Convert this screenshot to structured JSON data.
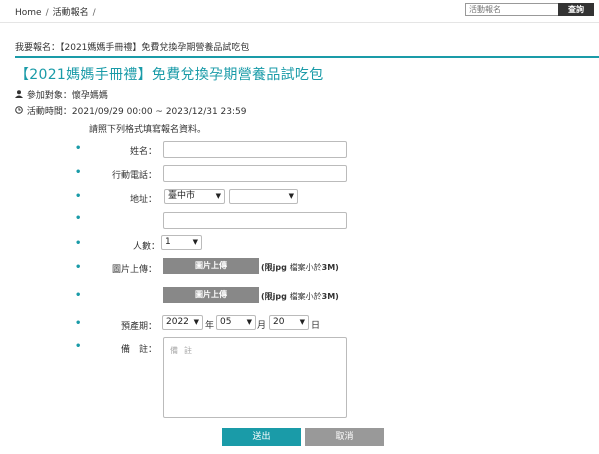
{
  "breadcrumb": {
    "home": "Home",
    "sep1": "/",
    "section": "活動報名",
    "sep2": "/"
  },
  "search": {
    "placeholder": "活動報名",
    "button": "查詢"
  },
  "page": {
    "header": "我要報名：【2021媽媽手冊禮】免費兌換孕期營養品試吃包",
    "title": "【2021媽媽手冊禮】免費兌換孕期營養品試吃包",
    "audience_label": "參加對象：",
    "audience": "懷孕媽媽",
    "period_label": "活動時間：",
    "period": "2021/09/29 00:00 ~ 2023/12/31 23:59",
    "note": "請照下列格式填寫報名資料。"
  },
  "form": {
    "bullet": "•",
    "name_label": "姓名：",
    "phone_label": "行動電話：",
    "address_label": "地址：",
    "city_value": "臺中市",
    "district_value": "",
    "people_label": "人數：",
    "people_value": "1",
    "upload_label": "圖片上傳：",
    "upload_button": "圖片上傳",
    "upload_tip_bold": "(限jpg",
    "upload_tip_mid": "檔案小於",
    "upload_tip_end": "3M)",
    "due_label": "預產期：",
    "year_value": "2022",
    "year_unit": "年",
    "month_value": "05",
    "month_unit": "月",
    "day_value": "20",
    "day_unit": "日",
    "remark_label": "備　註：",
    "remark_placeholder": "備註",
    "submit": "送出",
    "cancel": "取消"
  },
  "colors": {
    "accent": "#1a9ba8",
    "upload": "#888888",
    "cancel": "#999999"
  },
  "icons": {
    "audience": "user-icon",
    "period": "clock-icon",
    "select": "chevron-down-icon"
  }
}
